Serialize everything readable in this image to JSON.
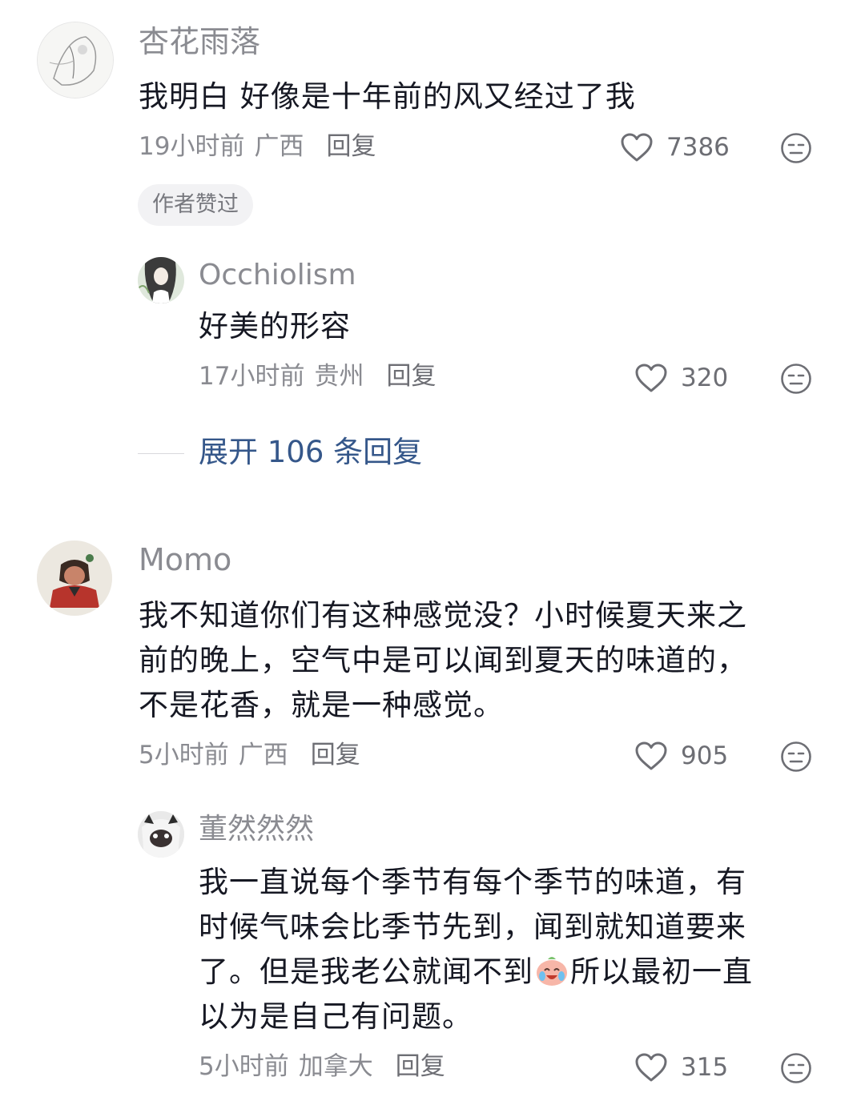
{
  "comments": [
    {
      "username": "杏花雨落",
      "text": "我明白 好像是十年前的风又经过了我",
      "time": "19小时前",
      "location": "广西",
      "reply_label": "回复",
      "likes": "7386",
      "badge": "作者赞过",
      "replies": [
        {
          "username": "Occhiolism",
          "text": "好美的形容",
          "time": "17小时前",
          "location": "贵州",
          "reply_label": "回复",
          "likes": "320"
        }
      ],
      "expand_label": "展开 106 条回复"
    },
    {
      "username": "Momo",
      "text": "我不知道你们有这种感觉没？小时候夏天来之\n前的晚上，空气中是可以闻到夏天的味道的，\n不是花香，就是一种感觉。",
      "time": "5小时前",
      "location": "广西",
      "reply_label": "回复",
      "likes": "905",
      "replies": [
        {
          "username": "董然然然",
          "text_part1": "我一直说每个季节有每个季节的味道，有\n时候气味会比季节先到，闻到就知道要来\n了。但是我老公就闻不到",
          "text_part2": "所以最初一直\n以为是自己有问题。",
          "inline_emoji": "crying-laughing-emoji",
          "time": "5小时前",
          "location": "加拿大",
          "reply_label": "回复",
          "likes": "315"
        }
      ]
    }
  ],
  "icons": {
    "like": "heart-outline-icon",
    "emotion": "expressionless-face-icon"
  },
  "colors": {
    "text": "#161823",
    "secondary": "#8a8b91",
    "link": "#35578a",
    "badge_bg": "#f2f2f4"
  }
}
